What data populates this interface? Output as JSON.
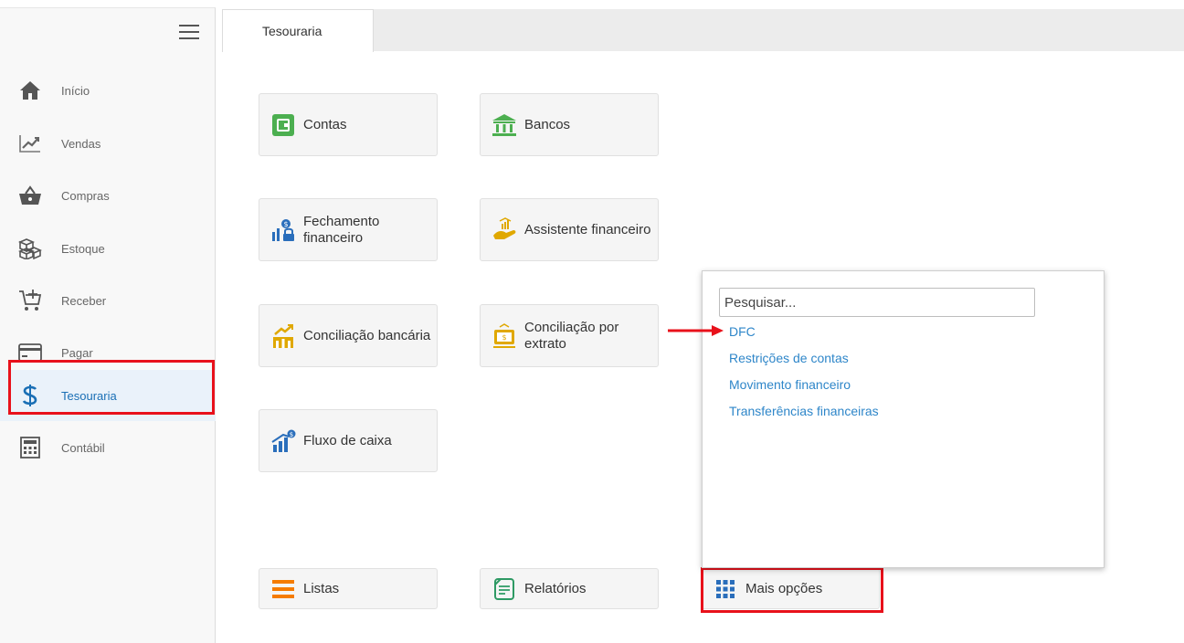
{
  "sidebar": {
    "items": [
      {
        "label": "Início",
        "icon": "home-icon"
      },
      {
        "label": "Vendas",
        "icon": "chart-line-icon"
      },
      {
        "label": "Compras",
        "icon": "basket-icon"
      },
      {
        "label": "Estoque",
        "icon": "boxes-icon"
      },
      {
        "label": "Receber",
        "icon": "cart-plus-icon"
      },
      {
        "label": "Pagar",
        "icon": "credit-card-icon"
      },
      {
        "label": "Tesouraria",
        "icon": "dollar-icon"
      },
      {
        "label": "Contábil",
        "icon": "calculator-icon"
      }
    ]
  },
  "tabs": [
    {
      "label": "Tesouraria"
    }
  ],
  "tiles": {
    "contas": "Contas",
    "bancos": "Bancos",
    "fechamento_line1": "Fechamento",
    "fechamento_line2": "financeiro",
    "assistente": "Assistente financeiro",
    "conciliacao_bancaria": "Conciliação bancária",
    "conciliacao_extrato_line1": "Conciliação por",
    "conciliacao_extrato_line2": "extrato",
    "fluxo": "Fluxo de caixa",
    "listas": "Listas",
    "relatorios": "Relatórios",
    "mais_opcoes": "Mais opções"
  },
  "dropdown": {
    "search_placeholder": "Pesquisar...",
    "items": [
      "DFC",
      "Restrições de contas",
      "Movimento financeiro",
      "Transferências financeiras"
    ]
  },
  "colors": {
    "accent_link": "#2e86c9",
    "highlight_red": "#e8111b",
    "green": "#4caf50",
    "orange": "#f57c00",
    "blue_grid": "#2a6ebb"
  }
}
